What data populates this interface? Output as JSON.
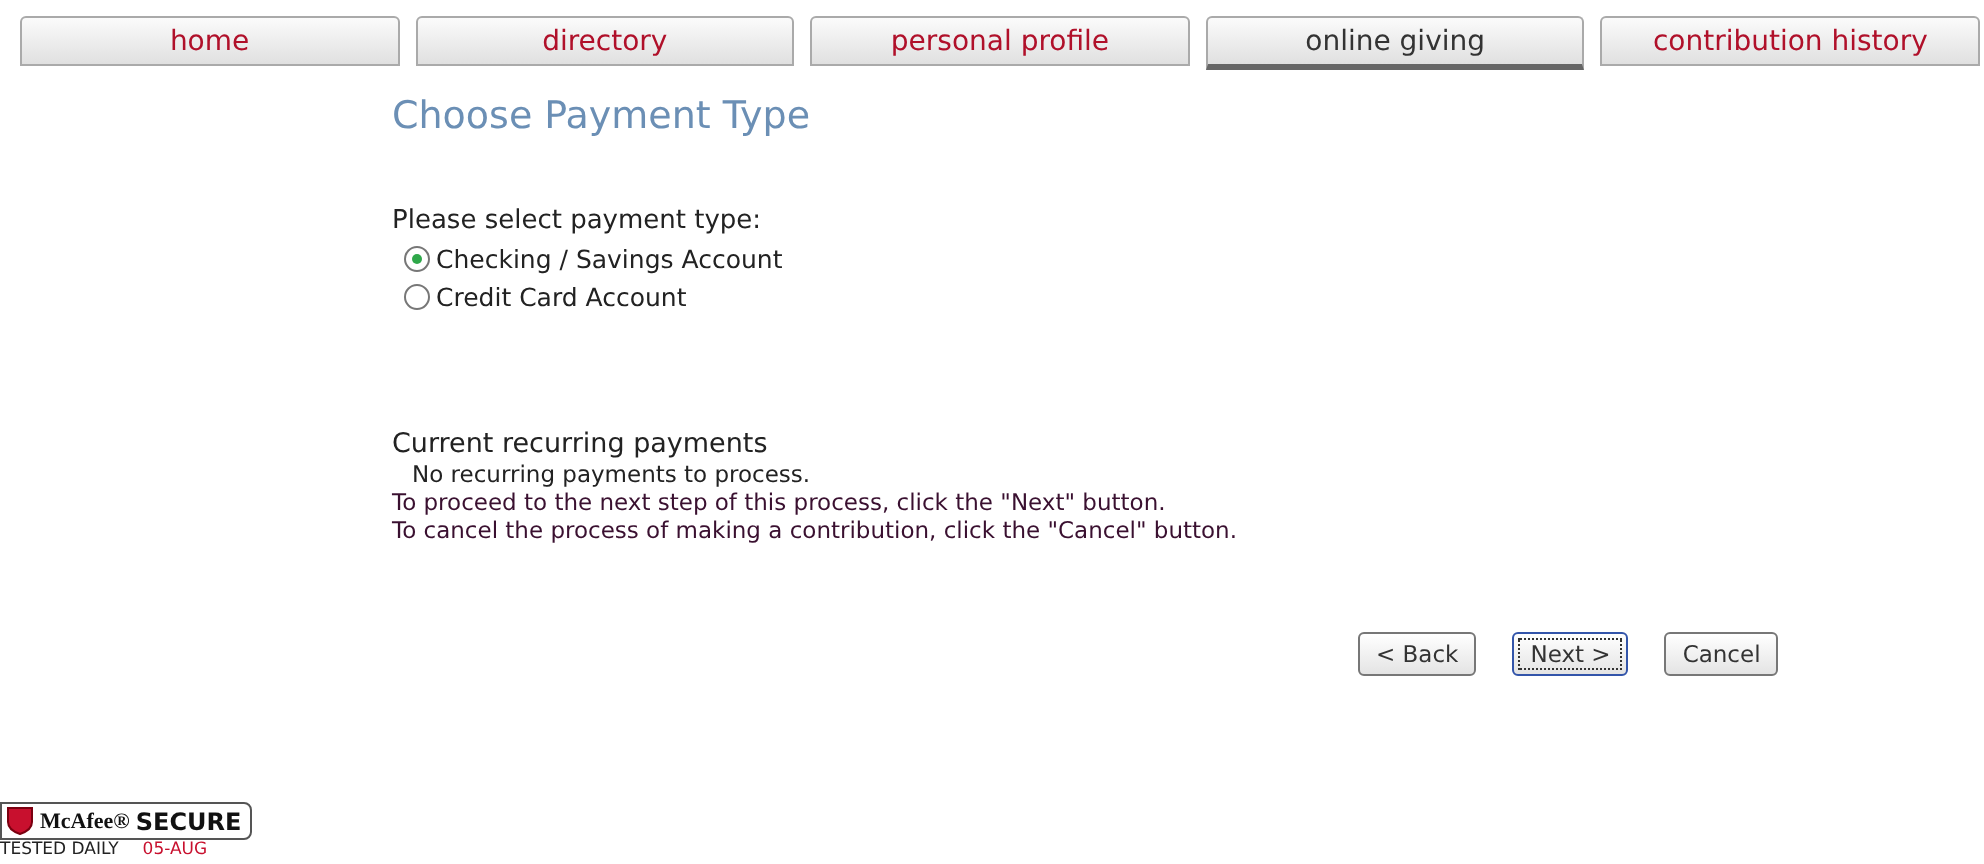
{
  "tabs": [
    {
      "label": "home",
      "selected": false
    },
    {
      "label": "directory",
      "selected": false
    },
    {
      "label": "personal profile",
      "selected": false
    },
    {
      "label": "online giving",
      "selected": true
    },
    {
      "label": "contribution history",
      "selected": false
    }
  ],
  "title": "Choose Payment Type",
  "payment_prompt": "Please select payment type:",
  "payment_options": [
    {
      "label": "Checking / Savings Account",
      "selected": true
    },
    {
      "label": "Credit Card Account",
      "selected": false
    }
  ],
  "recurring": {
    "heading": "Current recurring payments",
    "message": "No recurring payments to process."
  },
  "instructions": [
    "To proceed to the next step of this process, click the \"Next\" button.",
    "To cancel the process of making a contribution, click the \"Cancel\" button."
  ],
  "buttons": [
    {
      "label": "< Back",
      "focused": false
    },
    {
      "label": "Next >",
      "focused": true
    },
    {
      "label": "Cancel",
      "focused": false
    }
  ],
  "badge": {
    "brand": "McAfee®",
    "word": "SECURE",
    "tested": "TESTED DAILY",
    "date": "05-AUG"
  }
}
